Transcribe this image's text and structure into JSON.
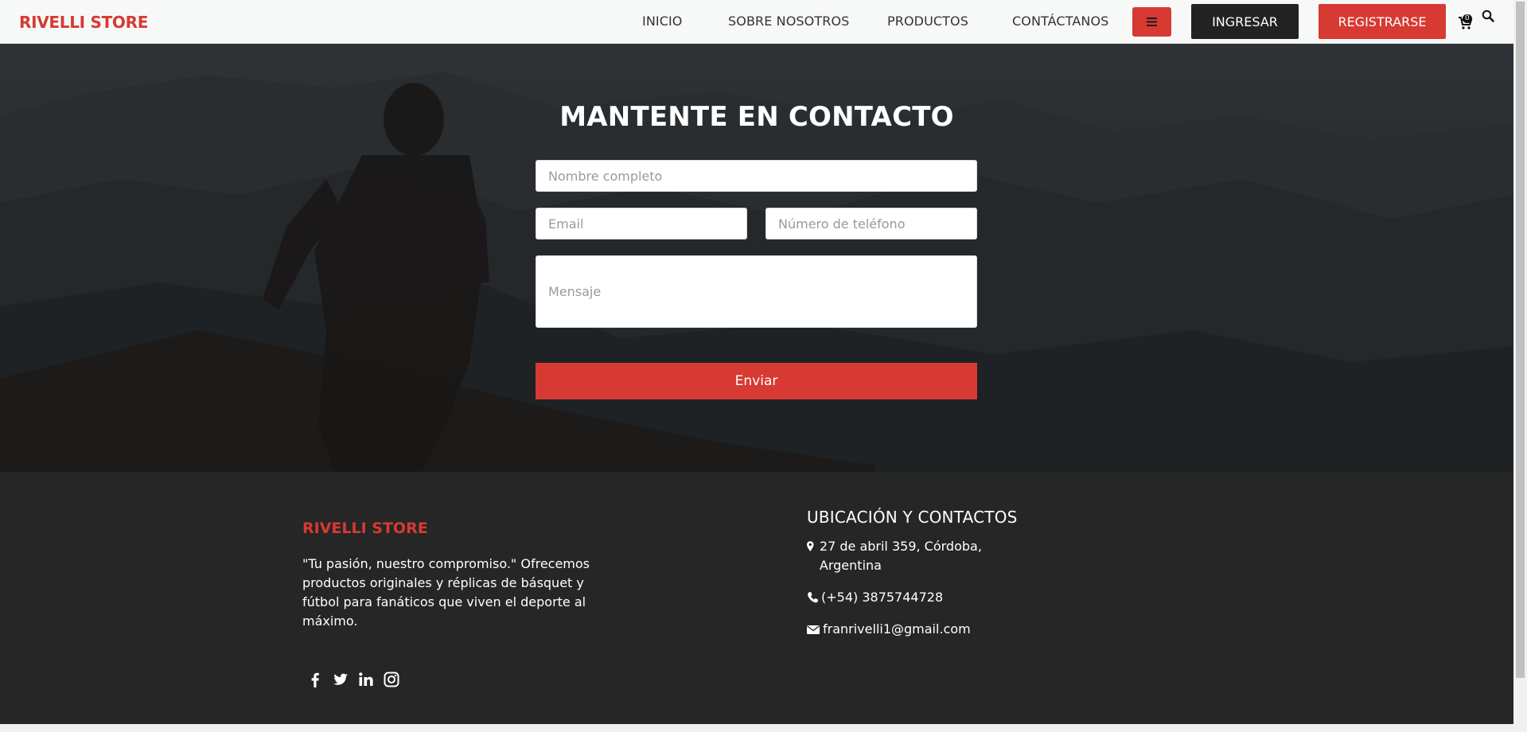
{
  "header": {
    "brand": "RIVELLI STORE",
    "nav": [
      "INICIO",
      "SOBRE NOSOTROS",
      "PRODUCTOS",
      "CONTÁCTANOS"
    ],
    "login_label": "INGRESAR",
    "register_label": "REGISTRARSE",
    "cart_count": "0"
  },
  "hero": {
    "title": "MANTENTE EN CONTACTO",
    "name_placeholder": "Nombre completo",
    "email_placeholder": "Email",
    "phone_placeholder": "Número de teléfono",
    "message_placeholder": "Mensaje",
    "send_label": "Enviar"
  },
  "footer": {
    "brand": "RIVELLI STORE",
    "description": "\"Tu pasión, nuestro compromiso.\" Ofrecemos productos originales y réplicas de básquet y fútbol para fanáticos que viven el deporte al máximo.",
    "heading": "UBICACIÓN Y CONTACTOS",
    "address": "27 de abril 359, Córdoba, Argentina",
    "phone": "(+54) 3875744728",
    "email": "franrivelli1@gmail.com",
    "socials": [
      "facebook-icon",
      "twitter-icon",
      "linkedin-icon",
      "instagram-icon"
    ]
  },
  "colors": {
    "accent": "#d63a32",
    "dark": "#222222",
    "footer_bg": "#262626"
  }
}
